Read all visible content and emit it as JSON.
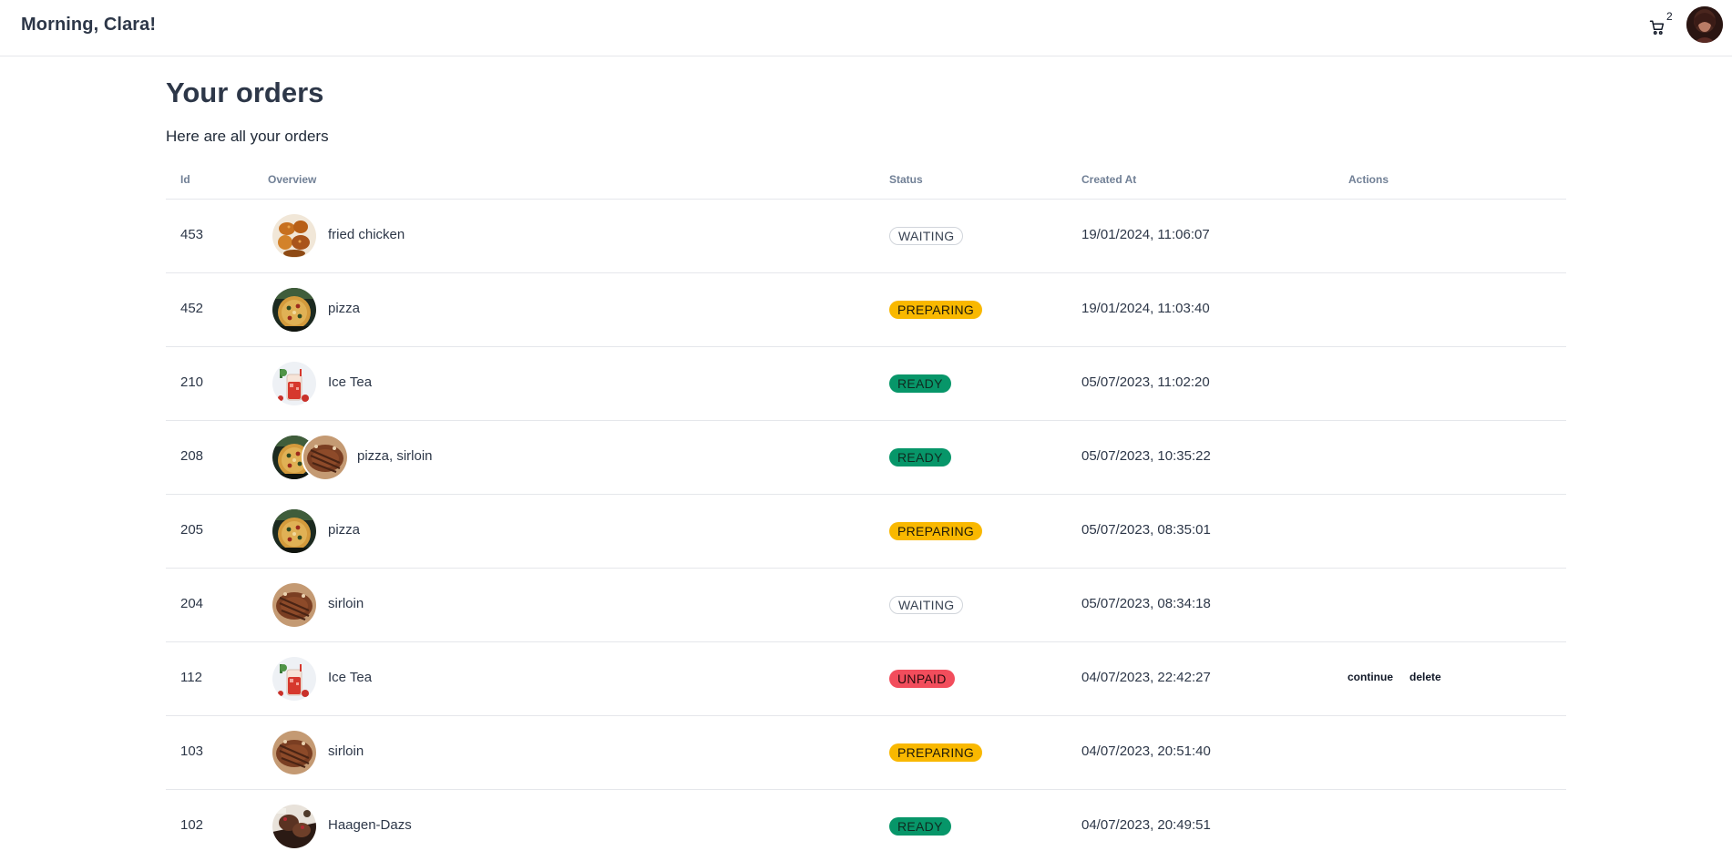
{
  "header": {
    "greeting": "Morning, Clara!",
    "cart_count": "2",
    "cart_icon": "cart-icon",
    "avatar_icon": "user-avatar"
  },
  "page": {
    "title": "Your orders",
    "subtitle": "Here are all your orders"
  },
  "table": {
    "columns": [
      "Id",
      "Overview",
      "Status",
      "Created At",
      "Actions"
    ],
    "rows": [
      {
        "id": "453",
        "items": "fried chicken",
        "thumbs": [
          "chicken"
        ],
        "status": "WAITING",
        "status_kind": "waiting",
        "created": "19/01/2024, 11:06:07",
        "actions": []
      },
      {
        "id": "452",
        "items": "pizza",
        "thumbs": [
          "pizza"
        ],
        "status": "PREPARING",
        "status_kind": "preparing",
        "created": "19/01/2024, 11:03:40",
        "actions": []
      },
      {
        "id": "210",
        "items": "Ice Tea",
        "thumbs": [
          "icetea"
        ],
        "status": "READY",
        "status_kind": "ready",
        "created": "05/07/2023, 11:02:20",
        "actions": []
      },
      {
        "id": "208",
        "items": "pizza, sirloin",
        "thumbs": [
          "pizza",
          "sirloin"
        ],
        "status": "READY",
        "status_kind": "ready",
        "created": "05/07/2023, 10:35:22",
        "actions": []
      },
      {
        "id": "205",
        "items": "pizza",
        "thumbs": [
          "pizza"
        ],
        "status": "PREPARING",
        "status_kind": "preparing",
        "created": "05/07/2023, 08:35:01",
        "actions": []
      },
      {
        "id": "204",
        "items": "sirloin",
        "thumbs": [
          "sirloin"
        ],
        "status": "WAITING",
        "status_kind": "waiting",
        "created": "05/07/2023, 08:34:18",
        "actions": []
      },
      {
        "id": "112",
        "items": "Ice Tea",
        "thumbs": [
          "icetea"
        ],
        "status": "UNPAID",
        "status_kind": "unpaid",
        "created": "04/07/2023, 22:42:27",
        "actions": [
          "continue",
          "delete"
        ]
      },
      {
        "id": "103",
        "items": "sirloin",
        "thumbs": [
          "sirloin"
        ],
        "status": "PREPARING",
        "status_kind": "preparing",
        "created": "04/07/2023, 20:51:40",
        "actions": []
      },
      {
        "id": "102",
        "items": "Haagen-Dazs",
        "thumbs": [
          "haagendazs"
        ],
        "status": "READY",
        "status_kind": "ready",
        "created": "04/07/2023, 20:49:51",
        "actions": []
      }
    ]
  },
  "colors": {
    "waiting": "#ffffff",
    "preparing": "#f9b800",
    "ready": "#079669",
    "unpaid": "#f24d5c"
  }
}
